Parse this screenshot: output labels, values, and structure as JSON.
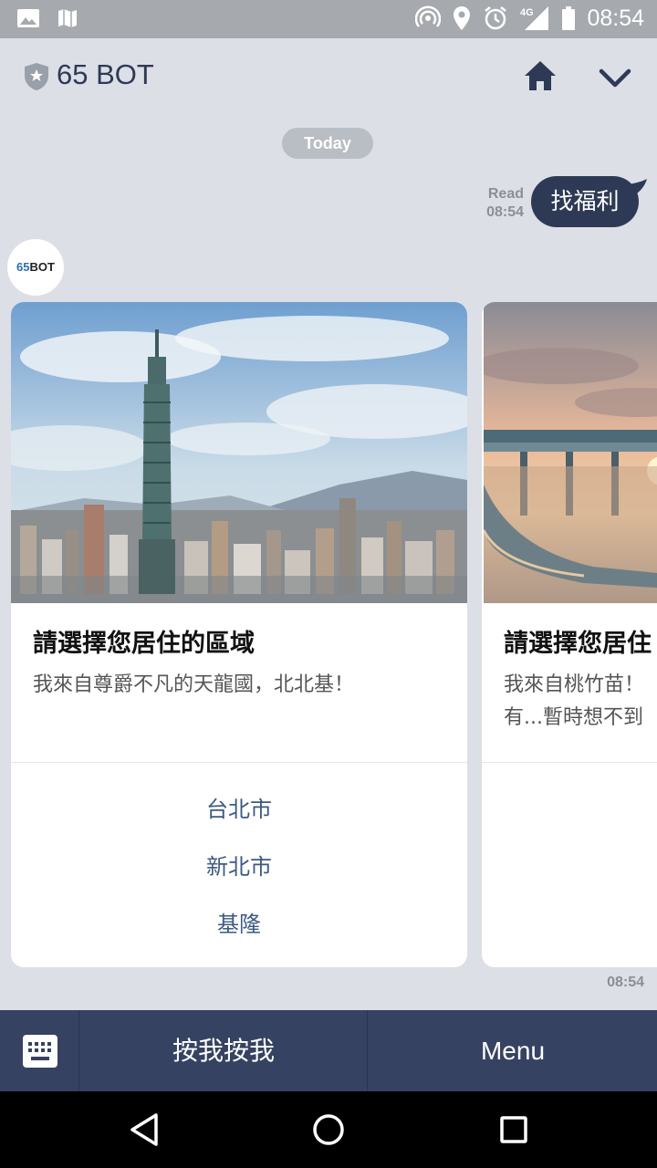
{
  "status_bar": {
    "time": "08:54",
    "network": "4G",
    "icons": [
      "image-icon",
      "map-icon",
      "hotspot-icon",
      "location-icon",
      "alarm-icon",
      "signal-icon",
      "battery-icon"
    ]
  },
  "header": {
    "title": "65 BOT",
    "icons": [
      "shield-star-icon",
      "home-icon",
      "chevron-down-icon"
    ]
  },
  "chat": {
    "date_label": "Today",
    "sent_message": {
      "read_label": "Read",
      "time": "08:54",
      "text": "找福利"
    },
    "bot": {
      "avatar_text_a": "65",
      "avatar_text_b": "BOT"
    },
    "carousel": [
      {
        "title": "請選擇您居住的區域",
        "description": "我來自尊爵不凡的天龍國，北北基！",
        "actions": [
          "台北市",
          "新北市",
          "基隆"
        ]
      },
      {
        "title": "請選擇您居住",
        "description_line1": "我來自桃竹苗！",
        "description_line2": "有...暫時想不到"
      }
    ],
    "message_time": "08:54"
  },
  "rich_menu": {
    "left_label": "按我按我",
    "right_label": "Menu"
  },
  "colors": {
    "accent": "#2e3a55",
    "menu_bar": "#364262",
    "chat_bg": "#dcdfe6",
    "link": "#3d5a84"
  }
}
